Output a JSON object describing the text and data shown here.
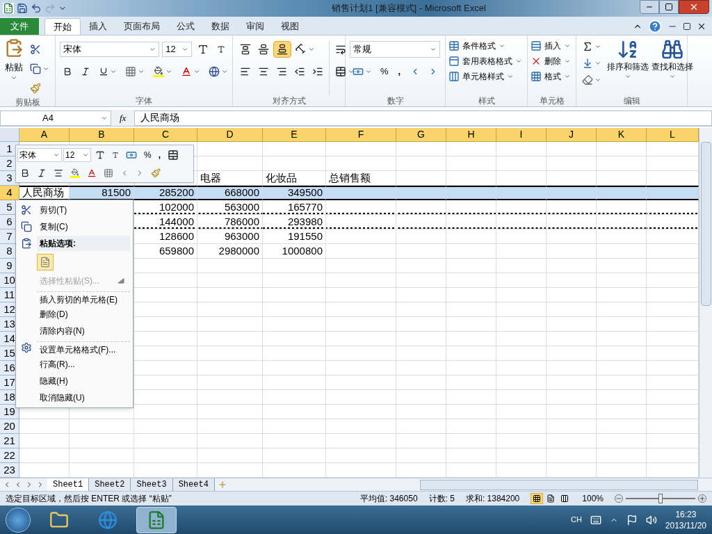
{
  "window": {
    "title": "销售计划1  [兼容模式]  -  Microsoft Excel"
  },
  "tabs": [
    {
      "label": "文件",
      "kind": "file",
      "selected": false
    },
    {
      "label": "开始",
      "kind": "tab",
      "selected": true
    },
    {
      "label": "插入",
      "kind": "tab",
      "selected": false
    },
    {
      "label": "页面布局",
      "kind": "tab",
      "selected": false
    },
    {
      "label": "公式",
      "kind": "tab",
      "selected": false
    },
    {
      "label": "数据",
      "kind": "tab",
      "selected": false
    },
    {
      "label": "审阅",
      "kind": "tab",
      "selected": false
    },
    {
      "label": "视图",
      "kind": "tab",
      "selected": false
    }
  ],
  "ribbon": {
    "clipboard": {
      "paste": "粘贴",
      "group": "剪贴板"
    },
    "font": {
      "font": "宋体",
      "size": "12",
      "group": "字体"
    },
    "alignment": {
      "group": "对齐方式"
    },
    "number": {
      "format": "常规",
      "percent": "%",
      "comma": ",",
      "group": "数字"
    },
    "styles": {
      "items": [
        "条件格式",
        "套用表格格式",
        "单元格样式"
      ],
      "group": "样式"
    },
    "cells": {
      "items": [
        "插入",
        "删除",
        "格式"
      ],
      "group": "单元格"
    },
    "editing": {
      "items": [
        "排序和筛选",
        "查找和选择"
      ],
      "group": "编辑"
    }
  },
  "formula_bar": {
    "name_box": "A4",
    "fx": "fx",
    "value": "人民商场"
  },
  "sheet": {
    "columns": [
      {
        "label": "A",
        "selected": true
      },
      {
        "label": "B",
        "selected": true
      },
      {
        "label": "C",
        "selected": true
      },
      {
        "label": "D",
        "selected": true
      },
      {
        "label": "E",
        "selected": true
      },
      {
        "label": "F",
        "selected": true
      },
      {
        "label": "G",
        "selected": true
      },
      {
        "label": "H",
        "selected": true
      },
      {
        "label": "I",
        "selected": true
      },
      {
        "label": "J",
        "selected": true
      },
      {
        "label": "K",
        "selected": true
      },
      {
        "label": "L",
        "selected": true
      }
    ],
    "rows": [
      {
        "num": "1",
        "selected": false,
        "marquee": false,
        "cells": []
      },
      {
        "num": "2",
        "selected": false,
        "marquee": false,
        "cells": []
      },
      {
        "num": "3",
        "selected": false,
        "marquee": false,
        "cells": [
          "",
          "",
          "",
          "电器",
          "化妆品",
          "总销售额"
        ]
      },
      {
        "num": "4",
        "selected": true,
        "marquee": false,
        "cells": [
          "人民商场",
          "81500",
          "285200",
          "668000",
          "349500"
        ]
      },
      {
        "num": "5",
        "selected": false,
        "marquee": true,
        "cells": [
          "",
          "",
          "102000",
          "563000",
          "165770"
        ]
      },
      {
        "num": "6",
        "selected": false,
        "marquee": true,
        "cells": [
          "",
          "",
          "144000",
          "786000",
          "293980"
        ]
      },
      {
        "num": "7",
        "selected": false,
        "marquee": false,
        "cells": [
          "",
          "",
          "128600",
          "963000",
          "191550"
        ]
      },
      {
        "num": "8",
        "selected": false,
        "marquee": false,
        "cells": [
          "",
          "",
          "659800",
          "2980000",
          "1000800"
        ]
      },
      {
        "num": "9",
        "selected": false,
        "marquee": false,
        "cells": []
      },
      {
        "num": "10",
        "selected": false,
        "marquee": false,
        "cells": []
      },
      {
        "num": "11",
        "selected": false,
        "marquee": false,
        "cells": []
      },
      {
        "num": "12",
        "selected": false,
        "marquee": false,
        "cells": []
      },
      {
        "num": "13",
        "selected": false,
        "marquee": false,
        "cells": []
      },
      {
        "num": "14",
        "selected": false,
        "marquee": false,
        "cells": []
      },
      {
        "num": "15",
        "selected": false,
        "marquee": false,
        "cells": []
      },
      {
        "num": "16",
        "selected": false,
        "marquee": false,
        "cells": []
      },
      {
        "num": "17",
        "selected": false,
        "marquee": false,
        "cells": []
      },
      {
        "num": "18",
        "selected": false,
        "marquee": false,
        "cells": []
      },
      {
        "num": "19",
        "selected": false,
        "marquee": false,
        "cells": []
      },
      {
        "num": "20",
        "selected": false,
        "marquee": false,
        "cells": []
      },
      {
        "num": "21",
        "selected": false,
        "marquee": false,
        "cells": []
      },
      {
        "num": "22",
        "selected": false,
        "marquee": false,
        "cells": []
      },
      {
        "num": "23",
        "selected": false,
        "marquee": false,
        "cells": []
      }
    ]
  },
  "mini_toolbar": {
    "font": "宋体",
    "size": "12",
    "percent": "%",
    "comma": ","
  },
  "context_menu": [
    {
      "kind": "cut",
      "label": "剪切(T)",
      "disabled": false,
      "separator_before": false
    },
    {
      "kind": "copy",
      "label": "复制(C)",
      "disabled": false,
      "separator_before": false
    },
    {
      "kind": "paste-header",
      "label": "粘贴选项:",
      "disabled": false,
      "separator_before": false
    },
    {
      "kind": "paste-options",
      "disabled": false,
      "separator_before": false
    },
    {
      "kind": "submenu",
      "label": "选择性粘贴(S)...",
      "disabled": true,
      "separator_before": false
    },
    {
      "kind": "item",
      "label": "插入剪切的单元格(E)",
      "disabled": false,
      "separator_before": true
    },
    {
      "kind": "item",
      "label": "删除(D)",
      "disabled": false,
      "separator_before": false
    },
    {
      "kind": "item",
      "label": "清除内容(N)",
      "disabled": false,
      "separator_before": false
    },
    {
      "kind": "format",
      "label": "设置单元格格式(F)...",
      "disabled": false,
      "separator_before": true
    },
    {
      "kind": "item",
      "label": "行高(R)...",
      "disabled": false,
      "separator_before": false
    },
    {
      "kind": "item",
      "label": "隐藏(H)",
      "disabled": false,
      "separator_before": false
    },
    {
      "kind": "item",
      "label": "取消隐藏(U)",
      "disabled": false,
      "separator_before": false
    }
  ],
  "sheet_tabs": [
    {
      "label": "Sheet1",
      "selected": true
    },
    {
      "label": "Sheet2",
      "selected": false
    },
    {
      "label": "Sheet3",
      "selected": false
    },
    {
      "label": "Sheet4",
      "selected": false
    }
  ],
  "status_bar": {
    "message": "选定目标区域，然后按 ENTER 或选择 “粘贴”",
    "average": "平均值: 346050",
    "count": "计数: 5",
    "sum": "求和: 1384200",
    "zoom": "100%",
    "zoom_slider": {
      "level": 0.5
    },
    "views": [
      {
        "kind": "normal",
        "selected": true
      },
      {
        "kind": "layout",
        "selected": false
      },
      {
        "kind": "break",
        "selected": false
      }
    ]
  },
  "taskbar": {
    "apps": [
      {
        "kind": "explorer",
        "selected": false
      },
      {
        "kind": "ie",
        "selected": false
      },
      {
        "kind": "excel",
        "selected": true
      }
    ],
    "language": "CH",
    "time": "16:23",
    "date": "2013/11/20"
  }
}
